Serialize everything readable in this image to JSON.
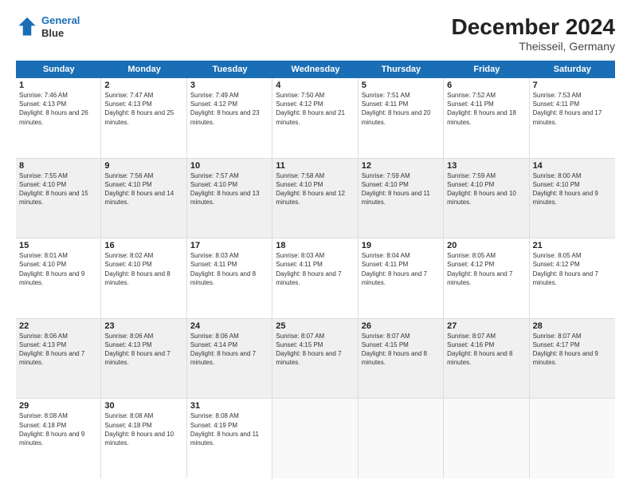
{
  "header": {
    "logo_line1": "General",
    "logo_line2": "Blue",
    "title": "December 2024",
    "subtitle": "Theisseil, Germany"
  },
  "calendar": {
    "days": [
      "Sunday",
      "Monday",
      "Tuesday",
      "Wednesday",
      "Thursday",
      "Friday",
      "Saturday"
    ],
    "rows": [
      [
        {
          "day": "1",
          "sunrise": "7:46 AM",
          "sunset": "4:13 PM",
          "daylight": "8 hours and 26 minutes."
        },
        {
          "day": "2",
          "sunrise": "7:47 AM",
          "sunset": "4:13 PM",
          "daylight": "8 hours and 25 minutes."
        },
        {
          "day": "3",
          "sunrise": "7:49 AM",
          "sunset": "4:12 PM",
          "daylight": "8 hours and 23 minutes."
        },
        {
          "day": "4",
          "sunrise": "7:50 AM",
          "sunset": "4:12 PM",
          "daylight": "8 hours and 21 minutes."
        },
        {
          "day": "5",
          "sunrise": "7:51 AM",
          "sunset": "4:11 PM",
          "daylight": "8 hours and 20 minutes."
        },
        {
          "day": "6",
          "sunrise": "7:52 AM",
          "sunset": "4:11 PM",
          "daylight": "8 hours and 18 minutes."
        },
        {
          "day": "7",
          "sunrise": "7:53 AM",
          "sunset": "4:11 PM",
          "daylight": "8 hours and 17 minutes."
        }
      ],
      [
        {
          "day": "8",
          "sunrise": "7:55 AM",
          "sunset": "4:10 PM",
          "daylight": "8 hours and 15 minutes."
        },
        {
          "day": "9",
          "sunrise": "7:56 AM",
          "sunset": "4:10 PM",
          "daylight": "8 hours and 14 minutes."
        },
        {
          "day": "10",
          "sunrise": "7:57 AM",
          "sunset": "4:10 PM",
          "daylight": "8 hours and 13 minutes."
        },
        {
          "day": "11",
          "sunrise": "7:58 AM",
          "sunset": "4:10 PM",
          "daylight": "8 hours and 12 minutes."
        },
        {
          "day": "12",
          "sunrise": "7:59 AM",
          "sunset": "4:10 PM",
          "daylight": "8 hours and 11 minutes."
        },
        {
          "day": "13",
          "sunrise": "7:59 AM",
          "sunset": "4:10 PM",
          "daylight": "8 hours and 10 minutes."
        },
        {
          "day": "14",
          "sunrise": "8:00 AM",
          "sunset": "4:10 PM",
          "daylight": "8 hours and 9 minutes."
        }
      ],
      [
        {
          "day": "15",
          "sunrise": "8:01 AM",
          "sunset": "4:10 PM",
          "daylight": "8 hours and 9 minutes."
        },
        {
          "day": "16",
          "sunrise": "8:02 AM",
          "sunset": "4:10 PM",
          "daylight": "8 hours and 8 minutes."
        },
        {
          "day": "17",
          "sunrise": "8:03 AM",
          "sunset": "4:11 PM",
          "daylight": "8 hours and 8 minutes."
        },
        {
          "day": "18",
          "sunrise": "8:03 AM",
          "sunset": "4:11 PM",
          "daylight": "8 hours and 7 minutes."
        },
        {
          "day": "19",
          "sunrise": "8:04 AM",
          "sunset": "4:11 PM",
          "daylight": "8 hours and 7 minutes."
        },
        {
          "day": "20",
          "sunrise": "8:05 AM",
          "sunset": "4:12 PM",
          "daylight": "8 hours and 7 minutes."
        },
        {
          "day": "21",
          "sunrise": "8:05 AM",
          "sunset": "4:12 PM",
          "daylight": "8 hours and 7 minutes."
        }
      ],
      [
        {
          "day": "22",
          "sunrise": "8:06 AM",
          "sunset": "4:13 PM",
          "daylight": "8 hours and 7 minutes."
        },
        {
          "day": "23",
          "sunrise": "8:06 AM",
          "sunset": "4:13 PM",
          "daylight": "8 hours and 7 minutes."
        },
        {
          "day": "24",
          "sunrise": "8:06 AM",
          "sunset": "4:14 PM",
          "daylight": "8 hours and 7 minutes."
        },
        {
          "day": "25",
          "sunrise": "8:07 AM",
          "sunset": "4:15 PM",
          "daylight": "8 hours and 7 minutes."
        },
        {
          "day": "26",
          "sunrise": "8:07 AM",
          "sunset": "4:15 PM",
          "daylight": "8 hours and 8 minutes."
        },
        {
          "day": "27",
          "sunrise": "8:07 AM",
          "sunset": "4:16 PM",
          "daylight": "8 hours and 8 minutes."
        },
        {
          "day": "28",
          "sunrise": "8:07 AM",
          "sunset": "4:17 PM",
          "daylight": "8 hours and 9 minutes."
        }
      ],
      [
        {
          "day": "29",
          "sunrise": "8:08 AM",
          "sunset": "4:18 PM",
          "daylight": "8 hours and 9 minutes."
        },
        {
          "day": "30",
          "sunrise": "8:08 AM",
          "sunset": "4:18 PM",
          "daylight": "8 hours and 10 minutes."
        },
        {
          "day": "31",
          "sunrise": "8:08 AM",
          "sunset": "4:19 PM",
          "daylight": "8 hours and 11 minutes."
        },
        null,
        null,
        null,
        null
      ]
    ],
    "labels": {
      "sunrise": "Sunrise:",
      "sunset": "Sunset:",
      "daylight": "Daylight:"
    }
  }
}
